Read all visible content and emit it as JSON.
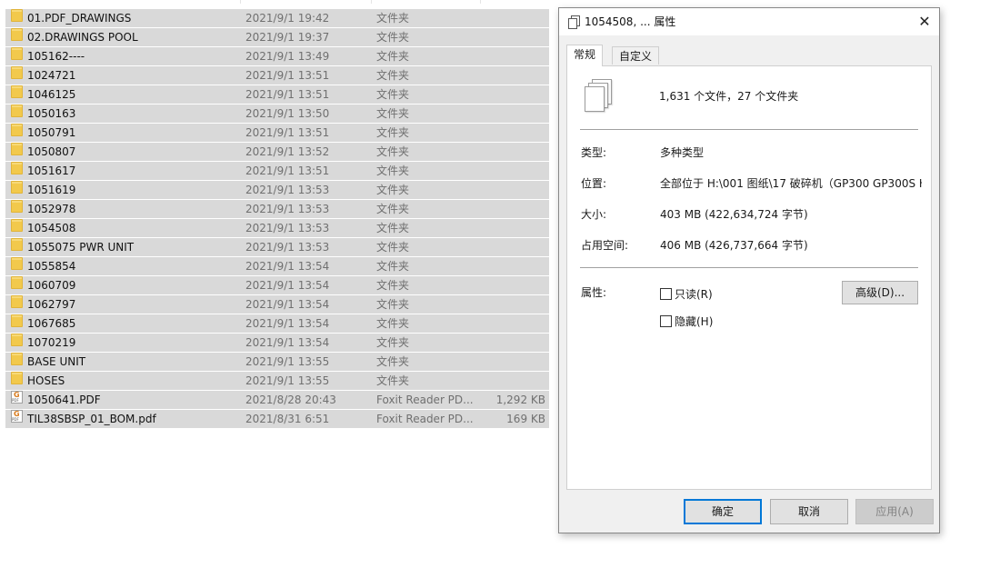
{
  "file_list": {
    "rows": [
      {
        "icon": "folder-icon",
        "name": "01.PDF_DRAWINGS",
        "date": "2021/9/1 19:42",
        "type": "文件夹",
        "size": ""
      },
      {
        "icon": "folder-icon",
        "name": "02.DRAWINGS POOL",
        "date": "2021/9/1 19:37",
        "type": "文件夹",
        "size": ""
      },
      {
        "icon": "folder-icon",
        "name": "105162----",
        "date": "2021/9/1 13:49",
        "type": "文件夹",
        "size": ""
      },
      {
        "icon": "folder-icon",
        "name": "1024721",
        "date": "2021/9/1 13:51",
        "type": "文件夹",
        "size": ""
      },
      {
        "icon": "folder-icon",
        "name": "1046125",
        "date": "2021/9/1 13:51",
        "type": "文件夹",
        "size": ""
      },
      {
        "icon": "folder-icon",
        "name": "1050163",
        "date": "2021/9/1 13:50",
        "type": "文件夹",
        "size": ""
      },
      {
        "icon": "folder-icon",
        "name": "1050791",
        "date": "2021/9/1 13:51",
        "type": "文件夹",
        "size": ""
      },
      {
        "icon": "folder-icon",
        "name": "1050807",
        "date": "2021/9/1 13:52",
        "type": "文件夹",
        "size": ""
      },
      {
        "icon": "folder-icon",
        "name": "1051617",
        "date": "2021/9/1 13:51",
        "type": "文件夹",
        "size": ""
      },
      {
        "icon": "folder-icon",
        "name": "1051619",
        "date": "2021/9/1 13:53",
        "type": "文件夹",
        "size": ""
      },
      {
        "icon": "folder-icon",
        "name": "1052978",
        "date": "2021/9/1 13:53",
        "type": "文件夹",
        "size": ""
      },
      {
        "icon": "folder-icon",
        "name": "1054508",
        "date": "2021/9/1 13:53",
        "type": "文件夹",
        "size": ""
      },
      {
        "icon": "folder-icon",
        "name": "1055075 PWR UNIT",
        "date": "2021/9/1 13:53",
        "type": "文件夹",
        "size": ""
      },
      {
        "icon": "folder-icon",
        "name": "1055854",
        "date": "2021/9/1 13:54",
        "type": "文件夹",
        "size": ""
      },
      {
        "icon": "folder-icon",
        "name": "1060709",
        "date": "2021/9/1 13:54",
        "type": "文件夹",
        "size": ""
      },
      {
        "icon": "folder-icon",
        "name": "1062797",
        "date": "2021/9/1 13:54",
        "type": "文件夹",
        "size": ""
      },
      {
        "icon": "folder-icon",
        "name": "1067685",
        "date": "2021/9/1 13:54",
        "type": "文件夹",
        "size": ""
      },
      {
        "icon": "folder-icon",
        "name": "1070219",
        "date": "2021/9/1 13:54",
        "type": "文件夹",
        "size": ""
      },
      {
        "icon": "folder-icon",
        "name": "BASE UNIT",
        "date": "2021/9/1 13:55",
        "type": "文件夹",
        "size": ""
      },
      {
        "icon": "folder-icon",
        "name": "HOSES",
        "date": "2021/9/1 13:55",
        "type": "文件夹",
        "size": ""
      },
      {
        "icon": "pdf-icon",
        "name": "1050641.PDF",
        "date": "2021/8/28 20:43",
        "type": "Foxit Reader PD...",
        "size": "1,292 KB"
      },
      {
        "icon": "pdf-icon",
        "name": "TIL38SBSP_01_BOM.pdf",
        "date": "2021/8/31 6:51",
        "type": "Foxit Reader PD...",
        "size": "169 KB"
      }
    ]
  },
  "dialog": {
    "title": "1054508, ... 属性",
    "close_label": "✕",
    "tabs": [
      "常规",
      "自定义"
    ],
    "summary": "1,631 个文件，27 个文件夹",
    "fields": {
      "type_label": "类型:",
      "type_value": "多种类型",
      "location_label": "位置:",
      "location_value": "全部位于 H:\\001 图纸\\17 破碎机（GP300 GP300S H",
      "size_label": "大小:",
      "size_value": "403 MB (422,634,724 字节)",
      "disk_label": "占用空间:",
      "disk_value": "406 MB (426,737,664 字节)",
      "attributes_label": "属性:",
      "readonly_label": "只读(R)",
      "hidden_label": "隐藏(H)",
      "advanced_label": "高级(D)..."
    },
    "buttons": {
      "ok": "确定",
      "cancel": "取消",
      "apply": "应用(A)"
    }
  }
}
